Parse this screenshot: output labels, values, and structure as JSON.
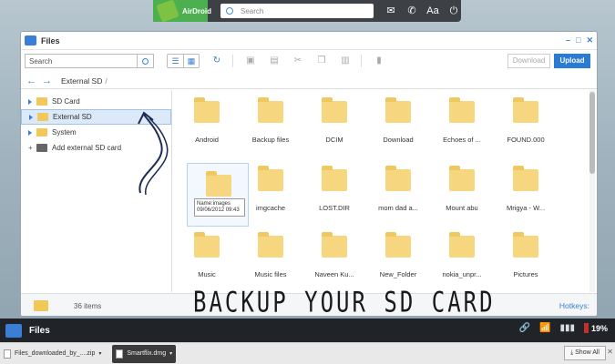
{
  "topbar": {
    "brand": "AirDroid",
    "search_placeholder": "Search",
    "icons": [
      "mail-icon",
      "phone-icon",
      "text-icon",
      "power-icon"
    ]
  },
  "window": {
    "title": "Files",
    "controls": [
      "minimize-icon",
      "maximize-icon",
      "close-icon"
    ],
    "toolbar": {
      "search_placeholder": "Search",
      "download_label": "Download",
      "upload_label": "Upload"
    },
    "breadcrumb": {
      "path": "External SD",
      "separator": "/"
    },
    "sidebar": [
      {
        "label": "SD Card",
        "kind": "folder"
      },
      {
        "label": "External SD",
        "kind": "folder",
        "selected": true
      },
      {
        "label": "System",
        "kind": "folder"
      },
      {
        "label": "Add external SD card",
        "kind": "add"
      }
    ],
    "files": [
      "Android",
      "Backup files",
      "DCIM",
      "Download",
      "Echoes of ...",
      "FOUND.000",
      "",
      "imgcache",
      "LOST.DIR",
      "mom dad a...",
      "Mount abu",
      "Mrigya - W...",
      "Music",
      "Music files",
      "Naveen Ku...",
      "New_Folder",
      "nokia_unpr...",
      "Pictures"
    ],
    "tooltip": {
      "name": "Name:images",
      "date": "09/06/2012 09:43"
    },
    "status": {
      "count": "36 items",
      "hotkeys": "Hotkeys:"
    }
  },
  "overlay_caption": "BACKUP YOUR SD CARD",
  "taskbar": {
    "app": "Files",
    "battery": "19%"
  },
  "downloads": {
    "item1": "Files_downloaded_by_....zip",
    "item2": "Smartflix.dmg",
    "show_all": "Show All"
  },
  "colors": {
    "accent": "#2a7bd6",
    "folder": "#f6d77f",
    "taskbar": "#202428"
  }
}
